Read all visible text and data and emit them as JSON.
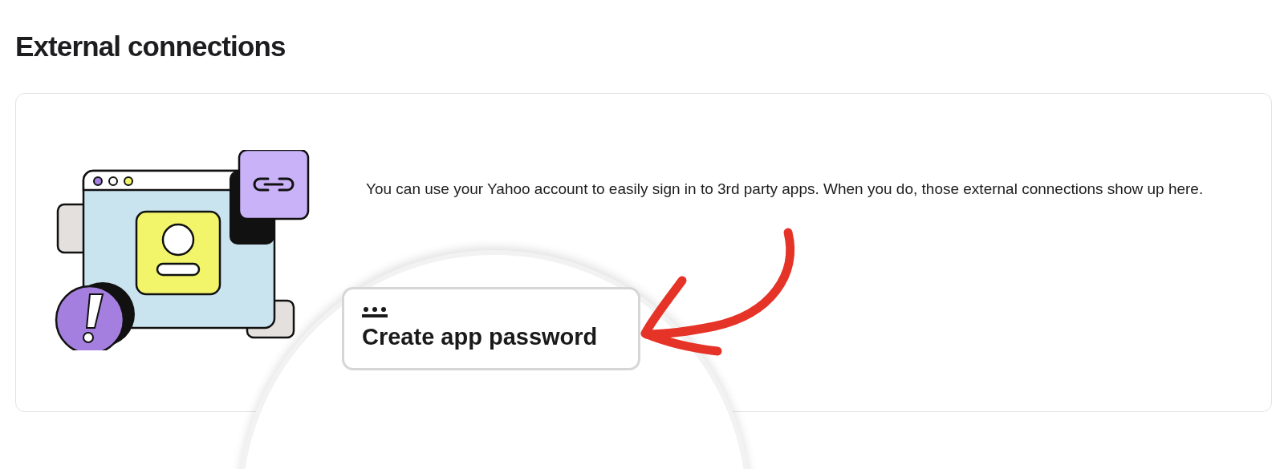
{
  "page": {
    "title": "External connections"
  },
  "card": {
    "description": "You can use your Yahoo account to easily sign in to 3rd party apps. When you do, those external connections show up here."
  },
  "magnifier": {
    "button": {
      "label": "Create app password"
    }
  }
}
